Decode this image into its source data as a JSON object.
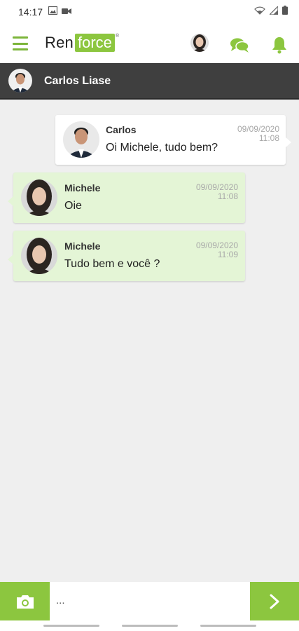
{
  "status_bar": {
    "time": "14:17",
    "icons": [
      "image-icon",
      "video-icon",
      "wifi-icon",
      "signal-icon",
      "battery-icon"
    ]
  },
  "header": {
    "logo_part1": "Ren",
    "logo_part2": "force",
    "logo_mark": "®",
    "icons": [
      "menu-icon",
      "profile-avatar",
      "chat-icon",
      "bell-icon"
    ],
    "accent_color": "#8cc63f"
  },
  "conversation": {
    "contact_name": "Carlos Liase"
  },
  "messages": [
    {
      "direction": "sent",
      "author": "Carlos",
      "text": "Oi Michele, tudo bem?",
      "date": "09/09/2020",
      "time": "11:08"
    },
    {
      "direction": "received",
      "author": "Michele",
      "text": "Oie",
      "date": "09/09/2020",
      "time": "11:08"
    },
    {
      "direction": "received",
      "author": "Michele",
      "text": "Tudo bem e você ?",
      "date": "09/09/2020",
      "time": "11:09"
    }
  ],
  "composer": {
    "placeholder": "...",
    "camera_icon": "camera-icon",
    "send_icon": "chevron-right-icon"
  },
  "colors": {
    "sent_bubble": "#ffffff",
    "received_bubble": "#e4f5d6",
    "conversation_bar": "#3f3f3f",
    "background": "#efefef"
  }
}
